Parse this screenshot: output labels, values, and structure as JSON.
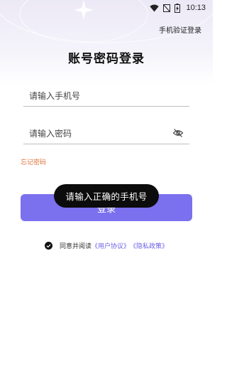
{
  "status_bar": {
    "time": "10:13",
    "icons": [
      "wifi-icon",
      "signal-off-icon",
      "battery-charging-icon"
    ]
  },
  "header": {
    "switch_login_link": "手机验证登录"
  },
  "title": "账号密码登录",
  "form": {
    "phone_placeholder": "请输入手机号",
    "phone_value": "",
    "password_placeholder": "请输入密码",
    "password_value": "",
    "password_toggle_icon": "eye-off-icon",
    "forgot_password": "忘记密码",
    "login_button": "登录"
  },
  "toast": "请输入正确的手机号",
  "agreement": {
    "checked": true,
    "prefix": "同意并阅读",
    "user_agreement": "《用户协议》",
    "privacy_policy": "《隐私政策》"
  },
  "colors": {
    "accent": "#7b70ee",
    "link": "#6b5fe6",
    "forgot": "#e2733b",
    "toast_bg": "#0c0c0c"
  }
}
